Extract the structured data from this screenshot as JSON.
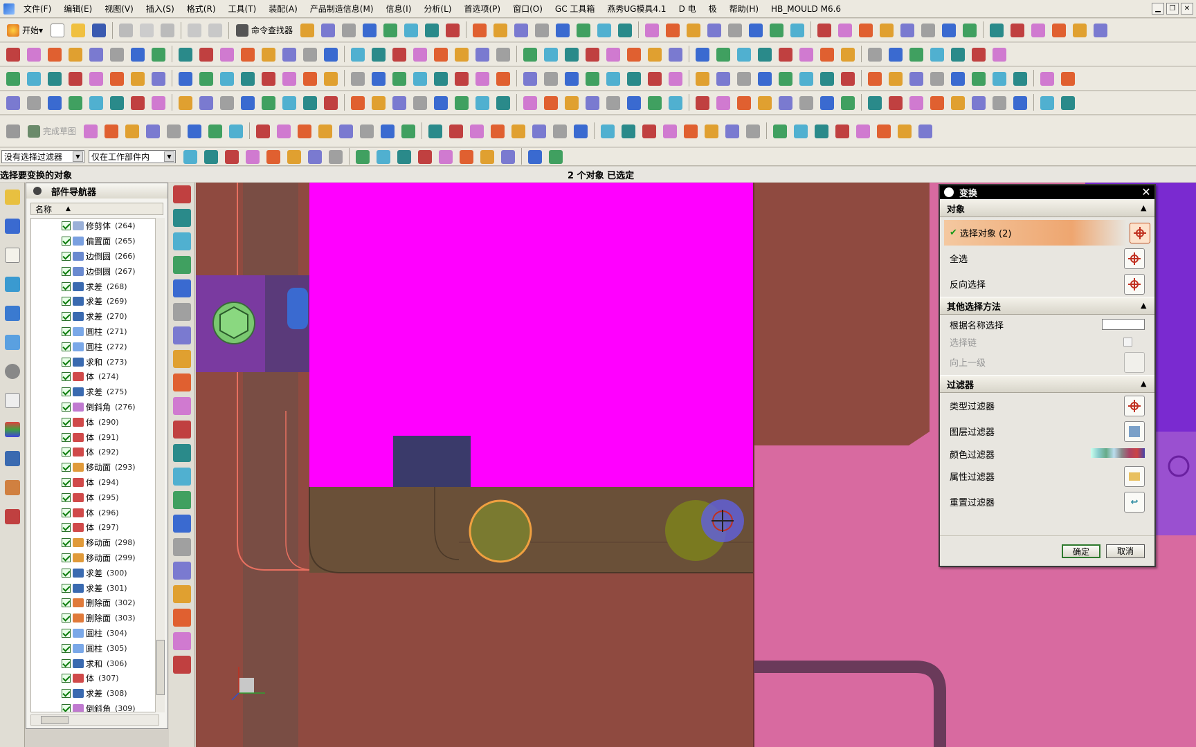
{
  "menubar": {
    "items": [
      "文件(F)",
      "编辑(E)",
      "视图(V)",
      "插入(S)",
      "格式(R)",
      "工具(T)",
      "装配(A)",
      "产品制造信息(M)",
      "信息(I)",
      "分析(L)",
      "首选项(P)",
      "窗口(O)",
      "GC 工具箱",
      "燕秀UG模具4.1",
      "D 电",
      "极",
      "帮助(H)",
      "HB_MOULD M6.6"
    ]
  },
  "toolbar": {
    "start_label": "开始",
    "command_finder_label": "命令查找器",
    "finish_sketch_label": "完成草图"
  },
  "filterbar": {
    "type_filter": "没有选择过滤器",
    "scope_filter": "仅在工作部件内"
  },
  "status": {
    "prompt": "选择要变换的对象",
    "selection": "2 个对象 已选定"
  },
  "navigator": {
    "title": "部件导航器",
    "column_name": "名称",
    "rows": [
      {
        "label": "修剪体",
        "num": "(264)",
        "color": "#9ab0d8"
      },
      {
        "label": "偏置面",
        "num": "(265)",
        "color": "#7aa0e0"
      },
      {
        "label": "边倒圆",
        "num": "(266)",
        "color": "#6a8ad0"
      },
      {
        "label": "边倒圆",
        "num": "(267)",
        "color": "#6a8ad0"
      },
      {
        "label": "求差",
        "num": "(268)",
        "color": "#3a6ab0"
      },
      {
        "label": "求差",
        "num": "(269)",
        "color": "#3a6ab0"
      },
      {
        "label": "求差",
        "num": "(270)",
        "color": "#3a6ab0"
      },
      {
        "label": "圆柱",
        "num": "(271)",
        "color": "#7aa8e8"
      },
      {
        "label": "圆柱",
        "num": "(272)",
        "color": "#7aa8e8"
      },
      {
        "label": "求和",
        "num": "(273)",
        "color": "#3a6ab0"
      },
      {
        "label": "体",
        "num": "(274)",
        "color": "#d04a4a"
      },
      {
        "label": "求差",
        "num": "(275)",
        "color": "#3a6ab0"
      },
      {
        "label": "倒斜角",
        "num": "(276)",
        "color": "#c07ad0"
      },
      {
        "label": "体",
        "num": "(290)",
        "color": "#d04a4a"
      },
      {
        "label": "体",
        "num": "(291)",
        "color": "#d04a4a"
      },
      {
        "label": "体",
        "num": "(292)",
        "color": "#d04a4a"
      },
      {
        "label": "移动面",
        "num": "(293)",
        "color": "#e09a3a"
      },
      {
        "label": "体",
        "num": "(294)",
        "color": "#d04a4a"
      },
      {
        "label": "体",
        "num": "(295)",
        "color": "#d04a4a"
      },
      {
        "label": "体",
        "num": "(296)",
        "color": "#d04a4a"
      },
      {
        "label": "体",
        "num": "(297)",
        "color": "#d04a4a"
      },
      {
        "label": "移动面",
        "num": "(298)",
        "color": "#e09a3a"
      },
      {
        "label": "移动面",
        "num": "(299)",
        "color": "#e09a3a"
      },
      {
        "label": "求差",
        "num": "(300)",
        "color": "#3a6ab0"
      },
      {
        "label": "求差",
        "num": "(301)",
        "color": "#3a6ab0"
      },
      {
        "label": "删除面",
        "num": "(302)",
        "color": "#e07a3a"
      },
      {
        "label": "删除面",
        "num": "(303)",
        "color": "#e07a3a"
      },
      {
        "label": "圆柱",
        "num": "(304)",
        "color": "#7aa8e8"
      },
      {
        "label": "圆柱",
        "num": "(305)",
        "color": "#7aa8e8"
      },
      {
        "label": "求和",
        "num": "(306)",
        "color": "#3a6ab0"
      },
      {
        "label": "体",
        "num": "(307)",
        "color": "#d04a4a"
      },
      {
        "label": "求差",
        "num": "(308)",
        "color": "#3a6ab0"
      },
      {
        "label": "倒斜角",
        "num": "(309)",
        "color": "#c07ad0"
      }
    ]
  },
  "dialog": {
    "title": "变换",
    "object_section": "对象",
    "select_object": "选择对象 (2)",
    "select_all": "全选",
    "invert_selection": "反向选择",
    "other_methods_section": "其他选择方法",
    "select_by_name": "根据名称选择",
    "select_chain": "选择链",
    "up_one_level": "向上一级",
    "filter_section": "过滤器",
    "type_filter": "类型过滤器",
    "layer_filter": "图层过滤器",
    "color_filter": "颜色过滤器",
    "attribute_filter": "属性过滤器",
    "reset_filter": "重置过滤器",
    "ok": "确定",
    "cancel": "取消"
  },
  "colors": {
    "magenta_body": "#ff00ff",
    "plate_red": "#8f4a40",
    "pink_plate": "#d86aa0",
    "purple_plate": "#7a2ad0",
    "selection_orange": "#eea670"
  }
}
